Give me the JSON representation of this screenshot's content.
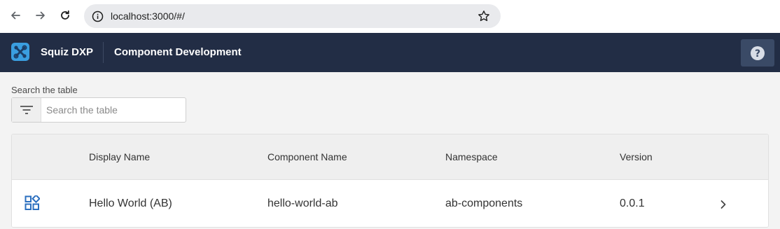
{
  "browser": {
    "url": "localhost:3000/#/"
  },
  "header": {
    "brand": "Squiz DXP",
    "title": "Component Development",
    "help_icon": "help-icon"
  },
  "search": {
    "label": "Search the table",
    "placeholder": "Search the table",
    "value": ""
  },
  "table": {
    "columns": [
      "Display Name",
      "Component Name",
      "Namespace",
      "Version"
    ],
    "rows": [
      {
        "display_name": "Hello World (AB)",
        "component_name": "hello-world-ab",
        "namespace": "ab-components",
        "version": "0.0.1"
      }
    ]
  },
  "colors": {
    "header_bg": "#222d45",
    "logo": "#3a9ee0",
    "help_button_bg": "#3a4a66",
    "accent_icon": "#2b6fbf"
  }
}
